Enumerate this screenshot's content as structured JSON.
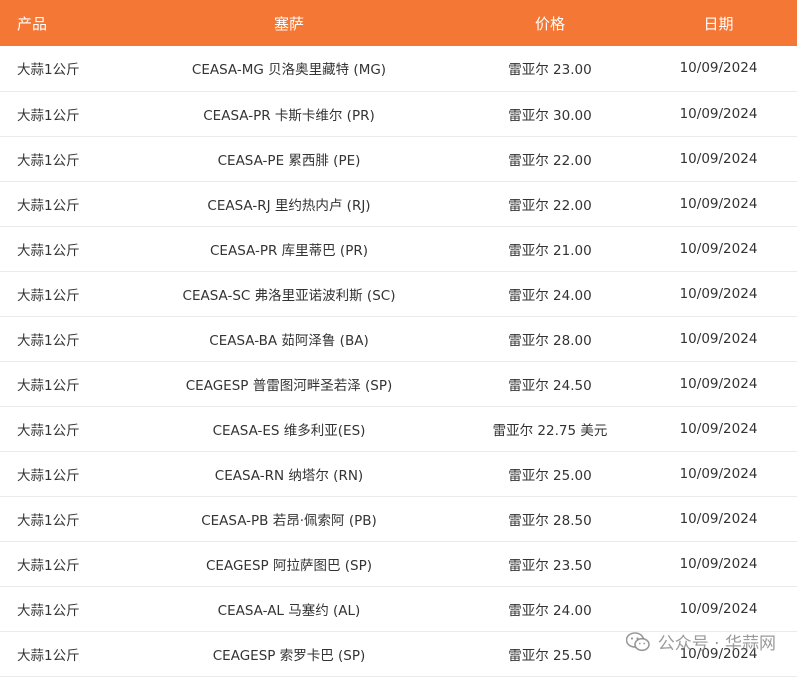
{
  "table": {
    "headers": {
      "product": "产品",
      "ceasa": "塞萨",
      "price": "价格",
      "date": "日期"
    },
    "rows": [
      {
        "product": "大蒜1公斤",
        "ceasa": "CEASA-MG 贝洛奥里藏特 (MG)",
        "price": "雷亚尔 23.00",
        "date": "10/09/2024"
      },
      {
        "product": "大蒜1公斤",
        "ceasa": "CEASA-PR 卡斯卡维尔 (PR)",
        "price": "雷亚尔 30.00",
        "date": "10/09/2024"
      },
      {
        "product": "大蒜1公斤",
        "ceasa": "CEASA-PE 累西腓 (PE)",
        "price": "雷亚尔 22.00",
        "date": "10/09/2024"
      },
      {
        "product": "大蒜1公斤",
        "ceasa": "CEASA-RJ 里约热内卢 (RJ)",
        "price": "雷亚尔 22.00",
        "date": "10/09/2024"
      },
      {
        "product": "大蒜1公斤",
        "ceasa": "CEASA-PR 库里蒂巴 (PR)",
        "price": "雷亚尔 21.00",
        "date": "10/09/2024"
      },
      {
        "product": "大蒜1公斤",
        "ceasa": "CEASA-SC 弗洛里亚诺波利斯 (SC)",
        "price": "雷亚尔 24.00",
        "date": "10/09/2024"
      },
      {
        "product": "大蒜1公斤",
        "ceasa": "CEASA-BA 茹阿泽鲁 (BA)",
        "price": "雷亚尔 28.00",
        "date": "10/09/2024"
      },
      {
        "product": "大蒜1公斤",
        "ceasa": "CEAGESP 普雷图河畔圣若泽 (SP)",
        "price": "雷亚尔 24.50",
        "date": "10/09/2024"
      },
      {
        "product": "大蒜1公斤",
        "ceasa": "CEASA-ES 维多利亚(ES)",
        "price": "雷亚尔 22.75 美元",
        "date": "10/09/2024"
      },
      {
        "product": "大蒜1公斤",
        "ceasa": "CEASA-RN 纳塔尔 (RN)",
        "price": "雷亚尔 25.00",
        "date": "10/09/2024"
      },
      {
        "product": "大蒜1公斤",
        "ceasa": "CEASA-PB 若昂·佩索阿 (PB)",
        "price": "雷亚尔 28.50",
        "date": "10/09/2024"
      },
      {
        "product": "大蒜1公斤",
        "ceasa": "CEAGESP 阿拉萨图巴 (SP)",
        "price": "雷亚尔 23.50",
        "date": "10/09/2024"
      },
      {
        "product": "大蒜1公斤",
        "ceasa": "CEASA-AL 马塞约 (AL)",
        "price": "雷亚尔 24.00",
        "date": "10/09/2024"
      },
      {
        "product": "大蒜1公斤",
        "ceasa": "CEAGESP 索罗卡巴 (SP)",
        "price": "雷亚尔 25.50",
        "date": "10/09/2024"
      }
    ]
  },
  "watermark": {
    "text": "公众号 · 华蒜网",
    "icon": "wechat-icon"
  },
  "colors": {
    "header_bg": "#f47735",
    "header_text": "#ffffff",
    "row_divider": "#eaeaea",
    "body_text": "#333333"
  }
}
